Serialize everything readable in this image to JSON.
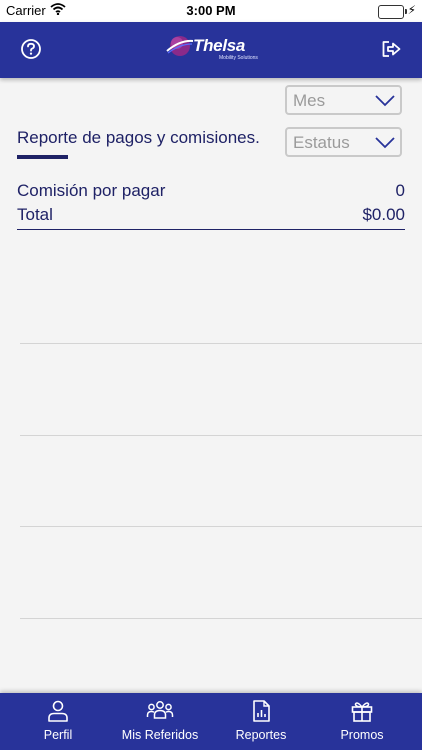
{
  "status_bar": {
    "carrier": "Carrier",
    "time": "3:00 PM",
    "battery_level": 1.0
  },
  "header": {
    "brand": "Thelsa",
    "tagline": "Mobility Solutions",
    "help_icon": "question-circle-icon",
    "logout_icon": "logout-icon"
  },
  "filters": {
    "month_placeholder": "Mes",
    "status_placeholder": "Estatus"
  },
  "report": {
    "title": "Reporte de pagos y comisiones.",
    "commission_label": "Comisión por pagar",
    "commission_value": "0",
    "total_label": "Total",
    "total_value": "$0.00"
  },
  "tabs": [
    {
      "label": "Perfil",
      "icon": "user-icon"
    },
    {
      "label": "Mis Referidos",
      "icon": "group-icon"
    },
    {
      "label": "Reportes",
      "icon": "report-icon"
    },
    {
      "label": "Promos",
      "icon": "gift-icon"
    }
  ],
  "colors": {
    "primary": "#28339a",
    "text_dark": "#1f2266",
    "background": "#f4f4f4"
  }
}
